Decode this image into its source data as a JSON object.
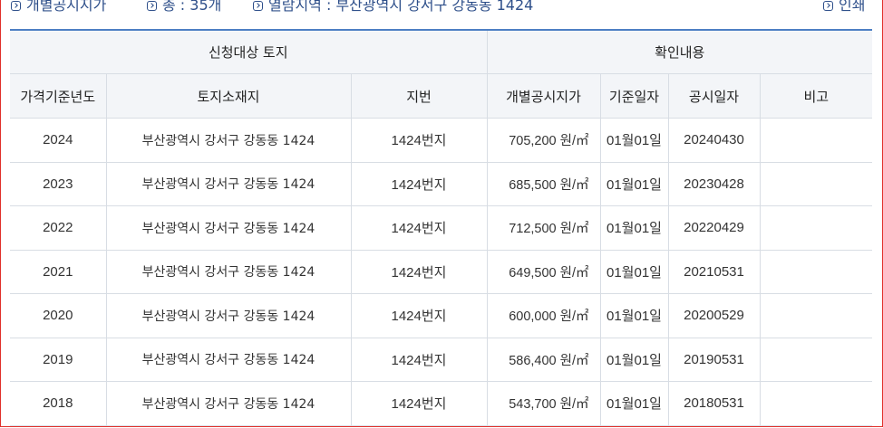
{
  "toolbar": {
    "title": "개별공시지가",
    "total": "총 : 35개",
    "area": "열람지역 : 부산광역시 강서구 강동동 1424",
    "print": "인쇄"
  },
  "table": {
    "group_headers": {
      "target": "신청대상 토지",
      "confirm": "확인내용"
    },
    "columns": [
      "가격기준년도",
      "토지소재지",
      "지번",
      "개별공시지가",
      "기준일자",
      "공시일자",
      "비고"
    ],
    "rows": [
      {
        "year": "2024",
        "address": "부산광역시 강서구 강동동 1424",
        "jibun": "1424번지",
        "price": "705,200 원/㎡",
        "base_date": "01월01일",
        "notice_date": "20240430",
        "note": ""
      },
      {
        "year": "2023",
        "address": "부산광역시 강서구 강동동 1424",
        "jibun": "1424번지",
        "price": "685,500 원/㎡",
        "base_date": "01월01일",
        "notice_date": "20230428",
        "note": ""
      },
      {
        "year": "2022",
        "address": "부산광역시 강서구 강동동 1424",
        "jibun": "1424번지",
        "price": "712,500 원/㎡",
        "base_date": "01월01일",
        "notice_date": "20220429",
        "note": ""
      },
      {
        "year": "2021",
        "address": "부산광역시 강서구 강동동 1424",
        "jibun": "1424번지",
        "price": "649,500 원/㎡",
        "base_date": "01월01일",
        "notice_date": "20210531",
        "note": ""
      },
      {
        "year": "2020",
        "address": "부산광역시 강서구 강동동 1424",
        "jibun": "1424번지",
        "price": "600,000 원/㎡",
        "base_date": "01월01일",
        "notice_date": "20200529",
        "note": ""
      },
      {
        "year": "2019",
        "address": "부산광역시 강서구 강동동 1424",
        "jibun": "1424번지",
        "price": "586,400 원/㎡",
        "base_date": "01월01일",
        "notice_date": "20190531",
        "note": ""
      },
      {
        "year": "2018",
        "address": "부산광역시 강서구 강동동 1424",
        "jibun": "1424번지",
        "price": "543,700 원/㎡",
        "base_date": "01월01일",
        "notice_date": "20180531",
        "note": ""
      }
    ]
  }
}
